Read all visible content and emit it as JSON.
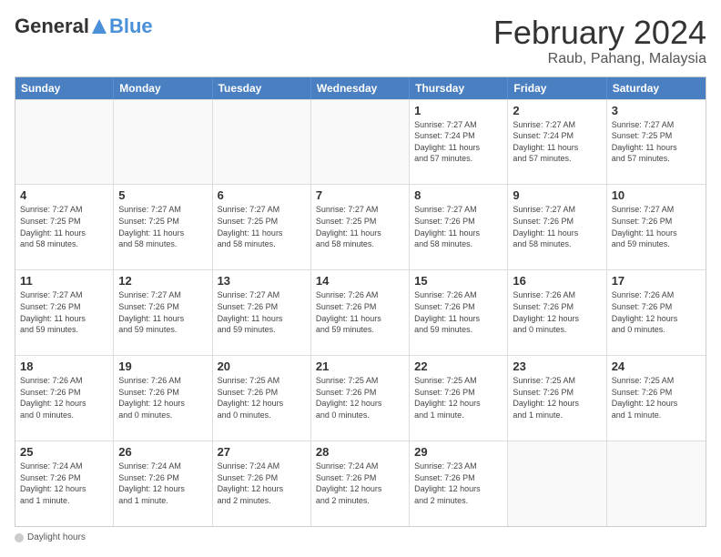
{
  "logo": {
    "general": "General",
    "blue": "Blue"
  },
  "title": {
    "month_year": "February 2024",
    "location": "Raub, Pahang, Malaysia"
  },
  "days_of_week": [
    "Sunday",
    "Monday",
    "Tuesday",
    "Wednesday",
    "Thursday",
    "Friday",
    "Saturday"
  ],
  "footer": {
    "label": "Daylight hours"
  },
  "weeks": [
    [
      {
        "day": "",
        "info": ""
      },
      {
        "day": "",
        "info": ""
      },
      {
        "day": "",
        "info": ""
      },
      {
        "day": "",
        "info": ""
      },
      {
        "day": "1",
        "info": "Sunrise: 7:27 AM\nSunset: 7:24 PM\nDaylight: 11 hours\nand 57 minutes."
      },
      {
        "day": "2",
        "info": "Sunrise: 7:27 AM\nSunset: 7:24 PM\nDaylight: 11 hours\nand 57 minutes."
      },
      {
        "day": "3",
        "info": "Sunrise: 7:27 AM\nSunset: 7:25 PM\nDaylight: 11 hours\nand 57 minutes."
      }
    ],
    [
      {
        "day": "4",
        "info": "Sunrise: 7:27 AM\nSunset: 7:25 PM\nDaylight: 11 hours\nand 58 minutes."
      },
      {
        "day": "5",
        "info": "Sunrise: 7:27 AM\nSunset: 7:25 PM\nDaylight: 11 hours\nand 58 minutes."
      },
      {
        "day": "6",
        "info": "Sunrise: 7:27 AM\nSunset: 7:25 PM\nDaylight: 11 hours\nand 58 minutes."
      },
      {
        "day": "7",
        "info": "Sunrise: 7:27 AM\nSunset: 7:25 PM\nDaylight: 11 hours\nand 58 minutes."
      },
      {
        "day": "8",
        "info": "Sunrise: 7:27 AM\nSunset: 7:26 PM\nDaylight: 11 hours\nand 58 minutes."
      },
      {
        "day": "9",
        "info": "Sunrise: 7:27 AM\nSunset: 7:26 PM\nDaylight: 11 hours\nand 58 minutes."
      },
      {
        "day": "10",
        "info": "Sunrise: 7:27 AM\nSunset: 7:26 PM\nDaylight: 11 hours\nand 59 minutes."
      }
    ],
    [
      {
        "day": "11",
        "info": "Sunrise: 7:27 AM\nSunset: 7:26 PM\nDaylight: 11 hours\nand 59 minutes."
      },
      {
        "day": "12",
        "info": "Sunrise: 7:27 AM\nSunset: 7:26 PM\nDaylight: 11 hours\nand 59 minutes."
      },
      {
        "day": "13",
        "info": "Sunrise: 7:27 AM\nSunset: 7:26 PM\nDaylight: 11 hours\nand 59 minutes."
      },
      {
        "day": "14",
        "info": "Sunrise: 7:26 AM\nSunset: 7:26 PM\nDaylight: 11 hours\nand 59 minutes."
      },
      {
        "day": "15",
        "info": "Sunrise: 7:26 AM\nSunset: 7:26 PM\nDaylight: 11 hours\nand 59 minutes."
      },
      {
        "day": "16",
        "info": "Sunrise: 7:26 AM\nSunset: 7:26 PM\nDaylight: 12 hours\nand 0 minutes."
      },
      {
        "day": "17",
        "info": "Sunrise: 7:26 AM\nSunset: 7:26 PM\nDaylight: 12 hours\nand 0 minutes."
      }
    ],
    [
      {
        "day": "18",
        "info": "Sunrise: 7:26 AM\nSunset: 7:26 PM\nDaylight: 12 hours\nand 0 minutes."
      },
      {
        "day": "19",
        "info": "Sunrise: 7:26 AM\nSunset: 7:26 PM\nDaylight: 12 hours\nand 0 minutes."
      },
      {
        "day": "20",
        "info": "Sunrise: 7:25 AM\nSunset: 7:26 PM\nDaylight: 12 hours\nand 0 minutes."
      },
      {
        "day": "21",
        "info": "Sunrise: 7:25 AM\nSunset: 7:26 PM\nDaylight: 12 hours\nand 0 minutes."
      },
      {
        "day": "22",
        "info": "Sunrise: 7:25 AM\nSunset: 7:26 PM\nDaylight: 12 hours\nand 1 minute."
      },
      {
        "day": "23",
        "info": "Sunrise: 7:25 AM\nSunset: 7:26 PM\nDaylight: 12 hours\nand 1 minute."
      },
      {
        "day": "24",
        "info": "Sunrise: 7:25 AM\nSunset: 7:26 PM\nDaylight: 12 hours\nand 1 minute."
      }
    ],
    [
      {
        "day": "25",
        "info": "Sunrise: 7:24 AM\nSunset: 7:26 PM\nDaylight: 12 hours\nand 1 minute."
      },
      {
        "day": "26",
        "info": "Sunrise: 7:24 AM\nSunset: 7:26 PM\nDaylight: 12 hours\nand 1 minute."
      },
      {
        "day": "27",
        "info": "Sunrise: 7:24 AM\nSunset: 7:26 PM\nDaylight: 12 hours\nand 2 minutes."
      },
      {
        "day": "28",
        "info": "Sunrise: 7:24 AM\nSunset: 7:26 PM\nDaylight: 12 hours\nand 2 minutes."
      },
      {
        "day": "29",
        "info": "Sunrise: 7:23 AM\nSunset: 7:26 PM\nDaylight: 12 hours\nand 2 minutes."
      },
      {
        "day": "",
        "info": ""
      },
      {
        "day": "",
        "info": ""
      }
    ]
  ]
}
